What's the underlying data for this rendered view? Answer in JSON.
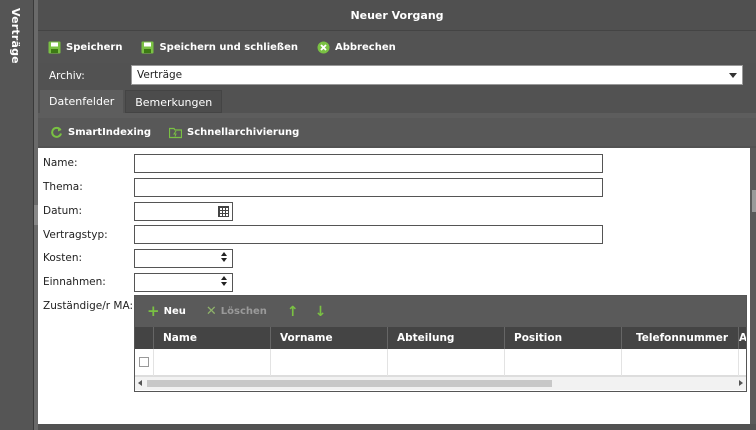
{
  "side_tab": {
    "label": "Verträge"
  },
  "window": {
    "title": "Neuer Vorgang"
  },
  "toolbar": {
    "save_label": "Speichern",
    "save_close_label": "Speichern und schließen",
    "cancel_label": "Abbrechen"
  },
  "archiv": {
    "label": "Archiv:",
    "value": "Verträge"
  },
  "tabs": [
    {
      "label": "Datenfelder",
      "active": true
    },
    {
      "label": "Bemerkungen",
      "active": false
    }
  ],
  "subbar": {
    "smart_label": "SmartIndexing",
    "quick_label": "Schnellarchivierung"
  },
  "fields": {
    "name_label": "Name:",
    "thema_label": "Thema:",
    "datum_label": "Datum:",
    "vertragstyp_label": "Vertragstyp:",
    "kosten_label": "Kosten:",
    "einnahmen_label": "Einnahmen:",
    "zustaendig_label": "Zuständige/r MA:"
  },
  "grid": {
    "new_label": "Neu",
    "delete_label": "Löschen",
    "up_icon": "↑",
    "down_icon": "↓",
    "columns": [
      "Name",
      "Vorname",
      "Abteilung",
      "Position",
      "Telefonnummer",
      "A"
    ]
  },
  "colors": {
    "accent_green": "#7ac143",
    "dark_bg": "#525252"
  }
}
